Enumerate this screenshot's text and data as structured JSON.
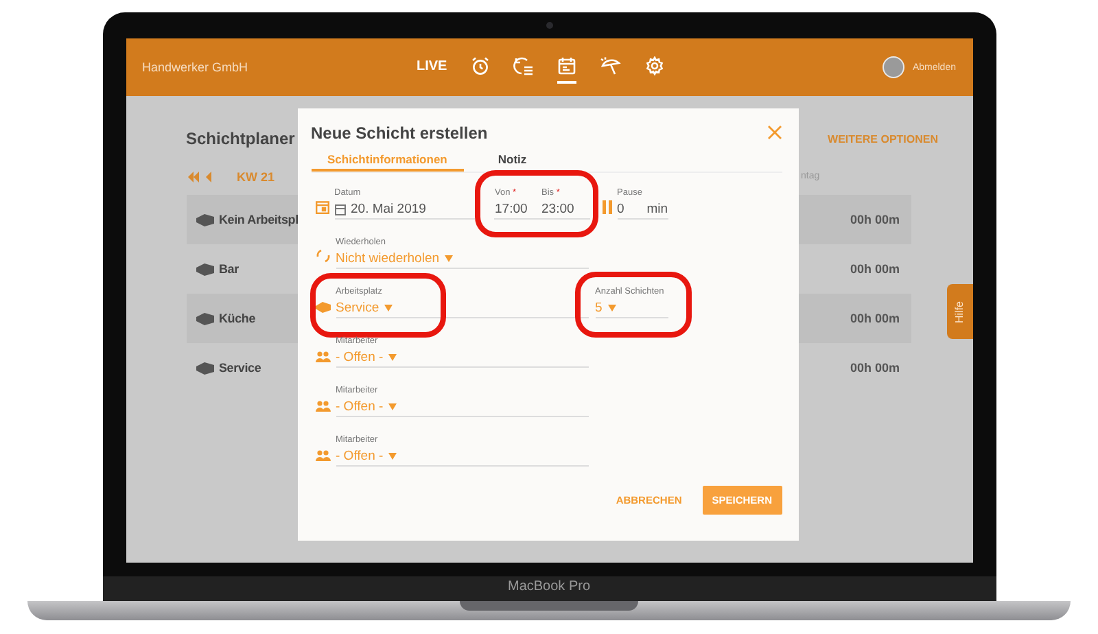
{
  "device": {
    "label": "MacBook Pro"
  },
  "header": {
    "company": "Handwerker GmbH",
    "nav": [
      {
        "kind": "text",
        "label": "LIVE",
        "selected": false
      },
      {
        "kind": "alarm",
        "selected": false
      },
      {
        "kind": "history",
        "selected": false
      },
      {
        "kind": "calendar",
        "selected": true
      },
      {
        "kind": "vacation",
        "selected": false
      },
      {
        "kind": "settings",
        "selected": false
      }
    ],
    "logout": "Abmelden"
  },
  "page": {
    "title": "Schichtplaner",
    "more_options": "WEITERE OPTIONEN",
    "week": "KW 21",
    "column_header": "ntag",
    "rows": [
      {
        "name": "Kein Arbeitspl",
        "total": "00h 00m"
      },
      {
        "name": "Bar",
        "total": "00h 00m"
      },
      {
        "name": "Küche",
        "total": "00h 00m"
      },
      {
        "name": "Service",
        "total": "00h 00m"
      }
    ],
    "help_tab": "Hilfe"
  },
  "dialog": {
    "title": "Neue Schicht erstellen",
    "tabs": [
      {
        "label": "Schichtinformationen",
        "selected": true
      },
      {
        "label": "Notiz",
        "selected": false
      }
    ],
    "date": {
      "label": "Datum",
      "value": "20. Mai 2019"
    },
    "from": {
      "label": "Von",
      "mark": "*",
      "value": "17:00",
      "highlighted": true
    },
    "to": {
      "label": "Bis",
      "mark": "*",
      "value": "23:00"
    },
    "pause": {
      "label": "Pause",
      "value": "0",
      "unit": "min"
    },
    "repeat": {
      "label": "Wiederholen",
      "value": "Nicht wiederholen"
    },
    "workplace": {
      "label": "Arbeitsplatz",
      "value": "Service",
      "highlighted": true
    },
    "shift_count": {
      "label": "Anzahl Schichten",
      "value": "5",
      "highlighted": true
    },
    "employees": [
      {
        "label": "Mitarbeiter",
        "value": "- Offen -"
      },
      {
        "label": "Mitarbeiter",
        "value": "- Offen -"
      },
      {
        "label": "Mitarbeiter",
        "value": "- Offen -"
      }
    ],
    "buttons": [
      {
        "kind": "text",
        "label": "ABBRECHEN"
      },
      {
        "kind": "primary",
        "label": "SPEICHERN"
      }
    ]
  }
}
